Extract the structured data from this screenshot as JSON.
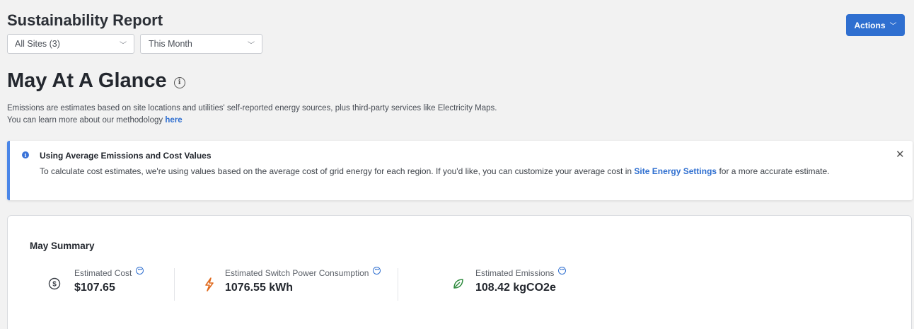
{
  "header": {
    "title": "Sustainability Report",
    "actions_label": "Actions",
    "sites_select": "All Sites (3)",
    "period_select": "This Month"
  },
  "glance": {
    "title": "May At A Glance",
    "description_text": "Emissions are estimates based on site locations and utilities' self-reported energy sources, plus third-party services like Electricity Maps. You can learn more about our methodology",
    "description_link": "here"
  },
  "banner": {
    "title": "Using Average Emissions and Cost Values",
    "body_text": "To calculate cost estimates, we're using values based on the average cost of grid energy for each region. If you'd like, you can customize your average cost in",
    "body_link": "Site Energy Settings",
    "body_tail": "for a more accurate estimate."
  },
  "summary": {
    "title": "May Summary",
    "metrics": [
      {
        "label": "Estimated Cost",
        "value": "$107.65",
        "icon": "dollar-icon"
      },
      {
        "label": "Estimated Switch Power Consumption",
        "value": "1076.55 kWh",
        "icon": "lightning-icon"
      },
      {
        "label": "Estimated Emissions",
        "value": "108.42 kgCO2e",
        "icon": "leaf-icon"
      }
    ]
  },
  "colors": {
    "accent": "#2f6fd0",
    "power": "#e0691c",
    "emissions": "#2e8b3e"
  }
}
